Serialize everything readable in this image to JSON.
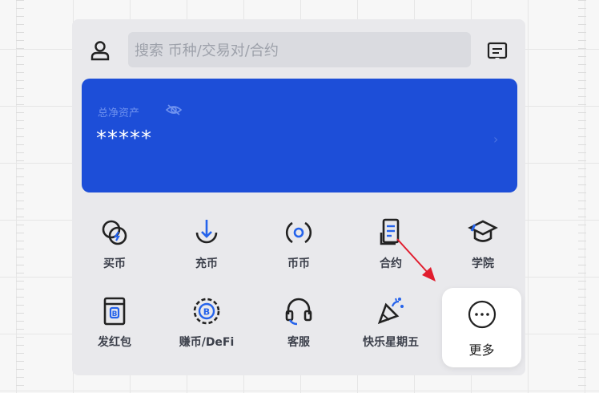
{
  "header": {
    "search_placeholder": "搜索 币种/交易对/合约",
    "user_icon": "user-icon",
    "message_icon": "message-icon"
  },
  "asset_card": {
    "label": "总净资产",
    "value": "*****",
    "chevron": "›",
    "background_color": "#1d4ed8"
  },
  "shortcuts": [
    {
      "label": "买币",
      "icon": "buy-coin-icon"
    },
    {
      "label": "充币",
      "icon": "deposit-icon"
    },
    {
      "label": "币币",
      "icon": "spot-icon"
    },
    {
      "label": "合约",
      "icon": "contract-icon"
    },
    {
      "label": "学院",
      "icon": "academy-icon"
    },
    {
      "label": "发红包",
      "icon": "red-packet-icon"
    },
    {
      "label": "赚币/DeFi",
      "icon": "earn-defi-icon"
    },
    {
      "label": "客服",
      "icon": "customer-service-icon"
    },
    {
      "label": "快乐星期五",
      "icon": "party-popper-icon"
    },
    {
      "label": "更多",
      "icon": "more-icon"
    }
  ],
  "annotation": {
    "arrow_color": "#e11d2e"
  }
}
